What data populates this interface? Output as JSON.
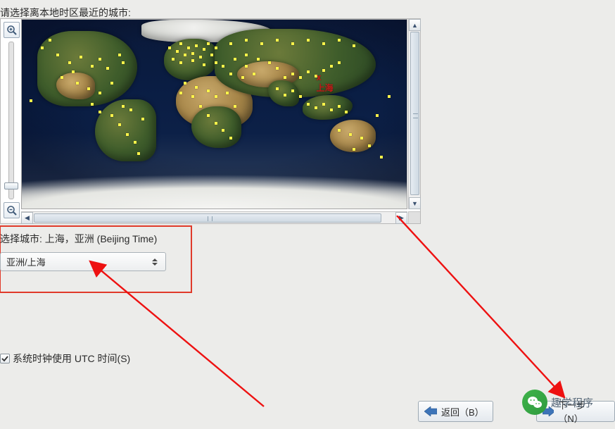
{
  "prompt": "请选择离本地时区最近的城市:",
  "zoom": {
    "in_icon": "zoom-in",
    "out_icon": "zoom-out"
  },
  "map": {
    "selected_marker": {
      "symbol": "x",
      "label": "上海"
    }
  },
  "selected_city_line": {
    "label": "选择城市:",
    "value": "上海，亚洲 (Beijing Time)"
  },
  "timezone_combo": {
    "value": "亚洲/上海"
  },
  "utc_checkbox": {
    "checked": true,
    "label": "系统时钟使用 UTC 时间(S)"
  },
  "buttons": {
    "back": "返回（B）",
    "next": "下一步（N）"
  },
  "watermark": "趣学程序"
}
